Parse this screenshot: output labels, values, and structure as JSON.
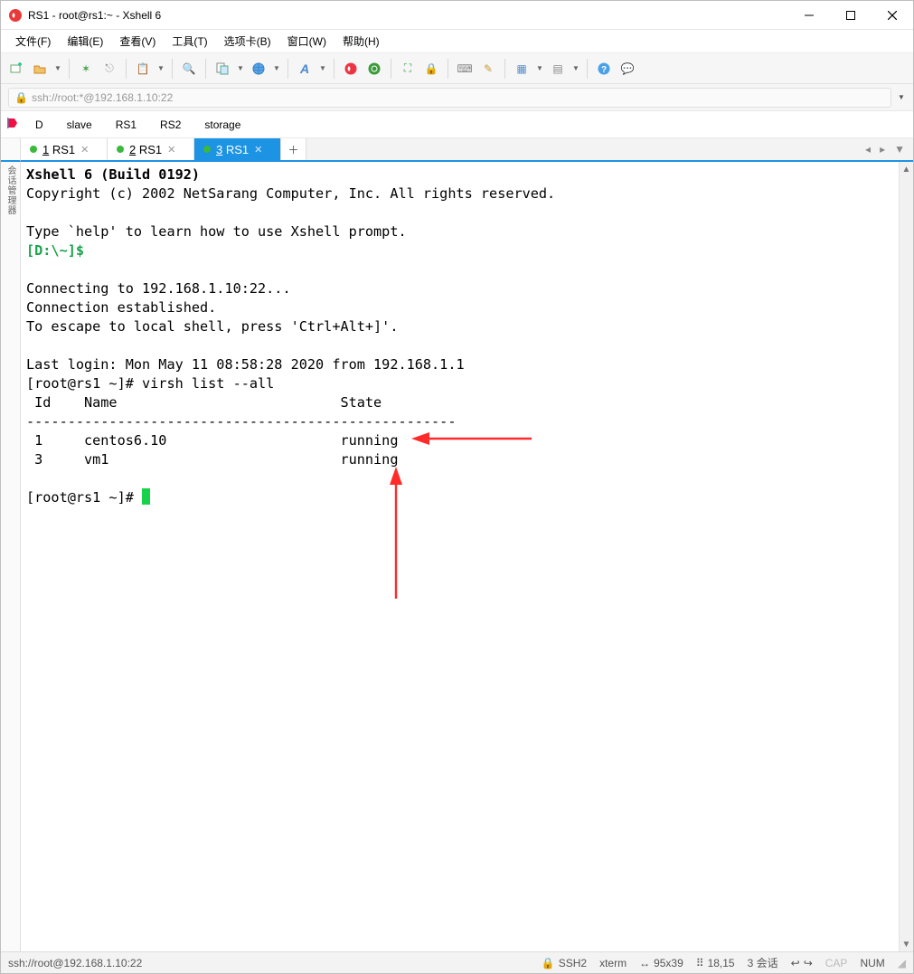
{
  "title": "RS1 - root@rs1:~ - Xshell 6",
  "menu": {
    "file": "文件(F)",
    "edit": "编辑(E)",
    "view": "查看(V)",
    "tools": "工具(T)",
    "tabs": "选项卡(B)",
    "window": "窗口(W)",
    "help": "帮助(H)"
  },
  "address": {
    "url": "ssh://root:*@192.168.1.10:22"
  },
  "sessions": {
    "items": [
      "D",
      "slave",
      "RS1",
      "RS2",
      "storage"
    ]
  },
  "tabs": {
    "t0": {
      "index": "1",
      "label": "RS1"
    },
    "t1": {
      "index": "2",
      "label": "RS1"
    },
    "t2": {
      "index": "3",
      "label": "RS1"
    }
  },
  "gutter": "会话管理器",
  "terminal": {
    "banner": "Xshell 6 (Build 0192)",
    "copyright": "Copyright (c) 2002 NetSarang Computer, Inc. All rights reserved.",
    "help_hint": "Type `help' to learn how to use Xshell prompt.",
    "local_prompt": "[D:\\~]$",
    "connecting": "Connecting to 192.168.1.10:22...",
    "established": "Connection established.",
    "escape": "To escape to local shell, press 'Ctrl+Alt+]'.",
    "last_login": "Last login: Mon May 11 08:58:28 2020 from 192.168.1.1",
    "prompt1": "[root@rs1 ~]# virsh list --all",
    "hdr": " Id    Name                           State",
    "divider": "----------------------------------------------------",
    "row1": " 1     centos6.10                     running",
    "row2": " 3     vm1                            running",
    "prompt2": "[root@rs1 ~]# "
  },
  "status": {
    "conn": "ssh://root@192.168.1.10:22",
    "proto": "SSH2",
    "term": "xterm",
    "size": "95x39",
    "pos": "18,15",
    "sess": "3 会话",
    "cap": "CAP",
    "num": "NUM"
  },
  "icons": {
    "new": "＋",
    "open": "📂",
    "reconnect": "🔄",
    "disconnect": "🔌",
    "props": "📋",
    "search": "🔍",
    "copy_paste": "📄",
    "globe": "🌐",
    "font": "A",
    "xshell": "🐚",
    "xftp": "⟳",
    "full": "⛶",
    "lock": "🔒",
    "kbd": "⌨",
    "highlight": "✎",
    "layout": "▦",
    "grid": "▤",
    "helpq": "?",
    "chat": "💬"
  }
}
